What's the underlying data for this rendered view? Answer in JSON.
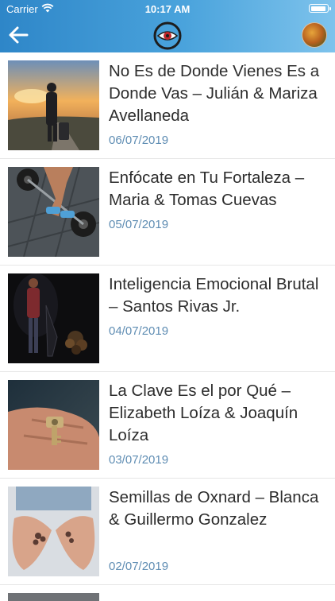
{
  "status_bar": {
    "carrier": "Carrier",
    "time": "10:17 AM"
  },
  "header": {
    "logo_icon": "vision-sin-limites-logo",
    "back_icon": "back-arrow-icon",
    "avatar_icon": "profile-avatar"
  },
  "colors": {
    "accent": "#3a96d4",
    "date": "#5f8db3",
    "title": "#2d2d2d"
  },
  "items": [
    {
      "title": "No Es de Donde Vienes Es a Donde Vas – Julián & Mariza Avellaneda",
      "date": "06/07/2019"
    },
    {
      "title": "Enfócate en Tu Fortaleza – Maria & Tomas Cuevas",
      "date": "05/07/2019"
    },
    {
      "title": "Inteligencia Emocional Brutal – Santos Rivas Jr.",
      "date": "04/07/2019"
    },
    {
      "title": "La Clave Es el por Qué – Elizabeth Loíza & Joaquín Loíza",
      "date": "03/07/2019"
    },
    {
      "title": "Semillas de Oxnard – Blanca & Guillermo Gonzalez",
      "date": "02/07/2019"
    }
  ]
}
